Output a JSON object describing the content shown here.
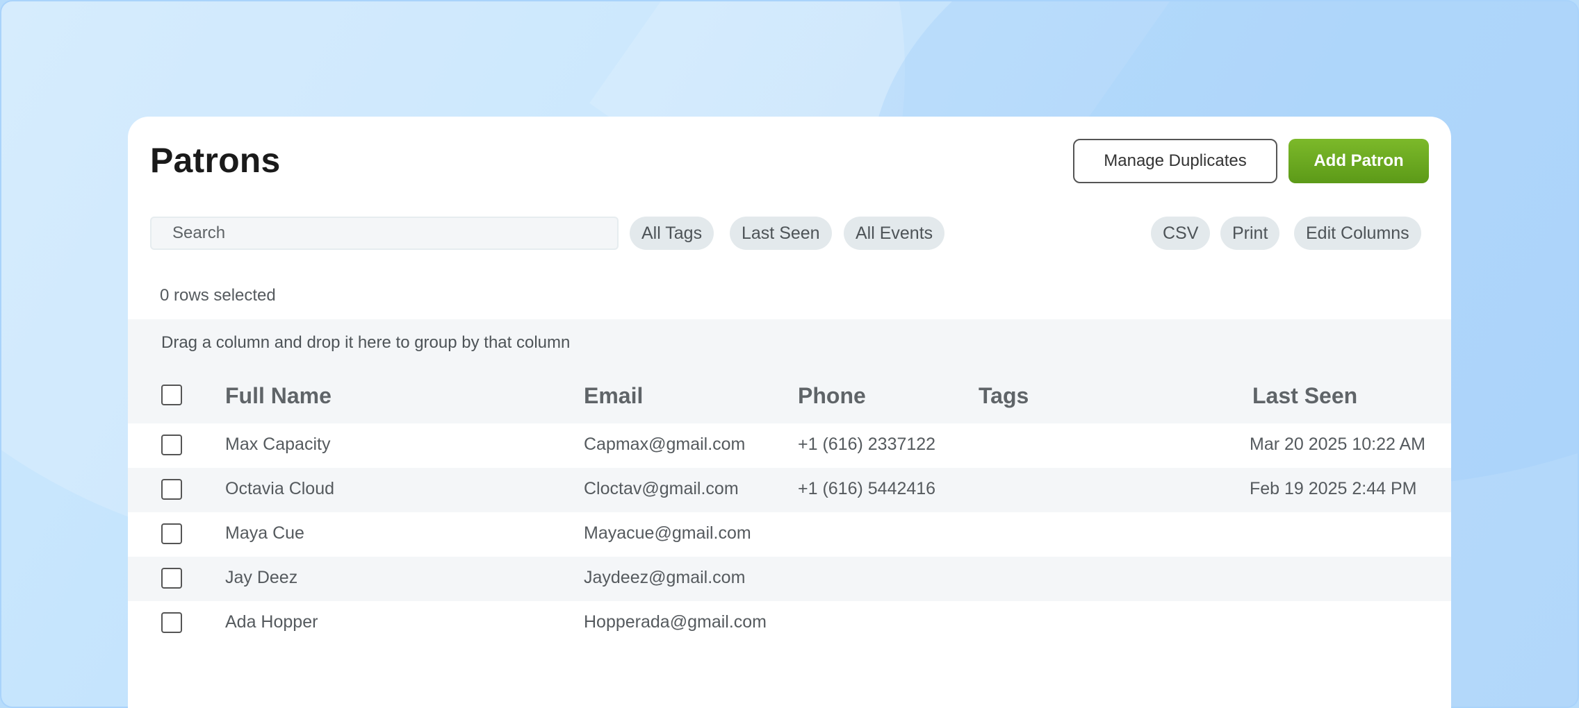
{
  "header": {
    "title": "Patrons",
    "manage_duplicates_label": "Manage Duplicates",
    "add_patron_label": "Add Patron"
  },
  "toolbar": {
    "search_placeholder": "Search",
    "filters": [
      "All Tags",
      "Last Seen",
      "All Events"
    ],
    "actions": [
      "CSV",
      "Print",
      "Edit Columns"
    ]
  },
  "selection": {
    "status": "0 rows selected"
  },
  "grid": {
    "group_hint": "Drag a column and drop it here to group by that column",
    "columns": [
      "Full Name",
      "Email",
      "Phone",
      "Tags",
      "Last Seen"
    ],
    "rows": [
      {
        "name": "Max Capacity",
        "email": "Capmax@gmail.com",
        "phone": "+1 (616) 2337122",
        "tags": "",
        "last_seen": "Mar 20 2025 10:22 AM"
      },
      {
        "name": "Octavia Cloud",
        "email": "Cloctav@gmail.com",
        "phone": "+1 (616) 5442416",
        "tags": "",
        "last_seen": "Feb 19 2025 2:44 PM"
      },
      {
        "name": "Maya Cue",
        "email": "Mayacue@gmail.com",
        "phone": "",
        "tags": "",
        "last_seen": ""
      },
      {
        "name": "Jay Deez",
        "email": "Jaydeez@gmail.com",
        "phone": "",
        "tags": "",
        "last_seen": ""
      },
      {
        "name": "Ada Hopper",
        "email": "Hopperada@gmail.com",
        "phone": "",
        "tags": "",
        "last_seen": ""
      }
    ]
  },
  "colors": {
    "primary_button": "#6aa81f",
    "background": "#b7dcfb",
    "stripe": "#f4f6f8",
    "chip": "#e3e9ec"
  }
}
